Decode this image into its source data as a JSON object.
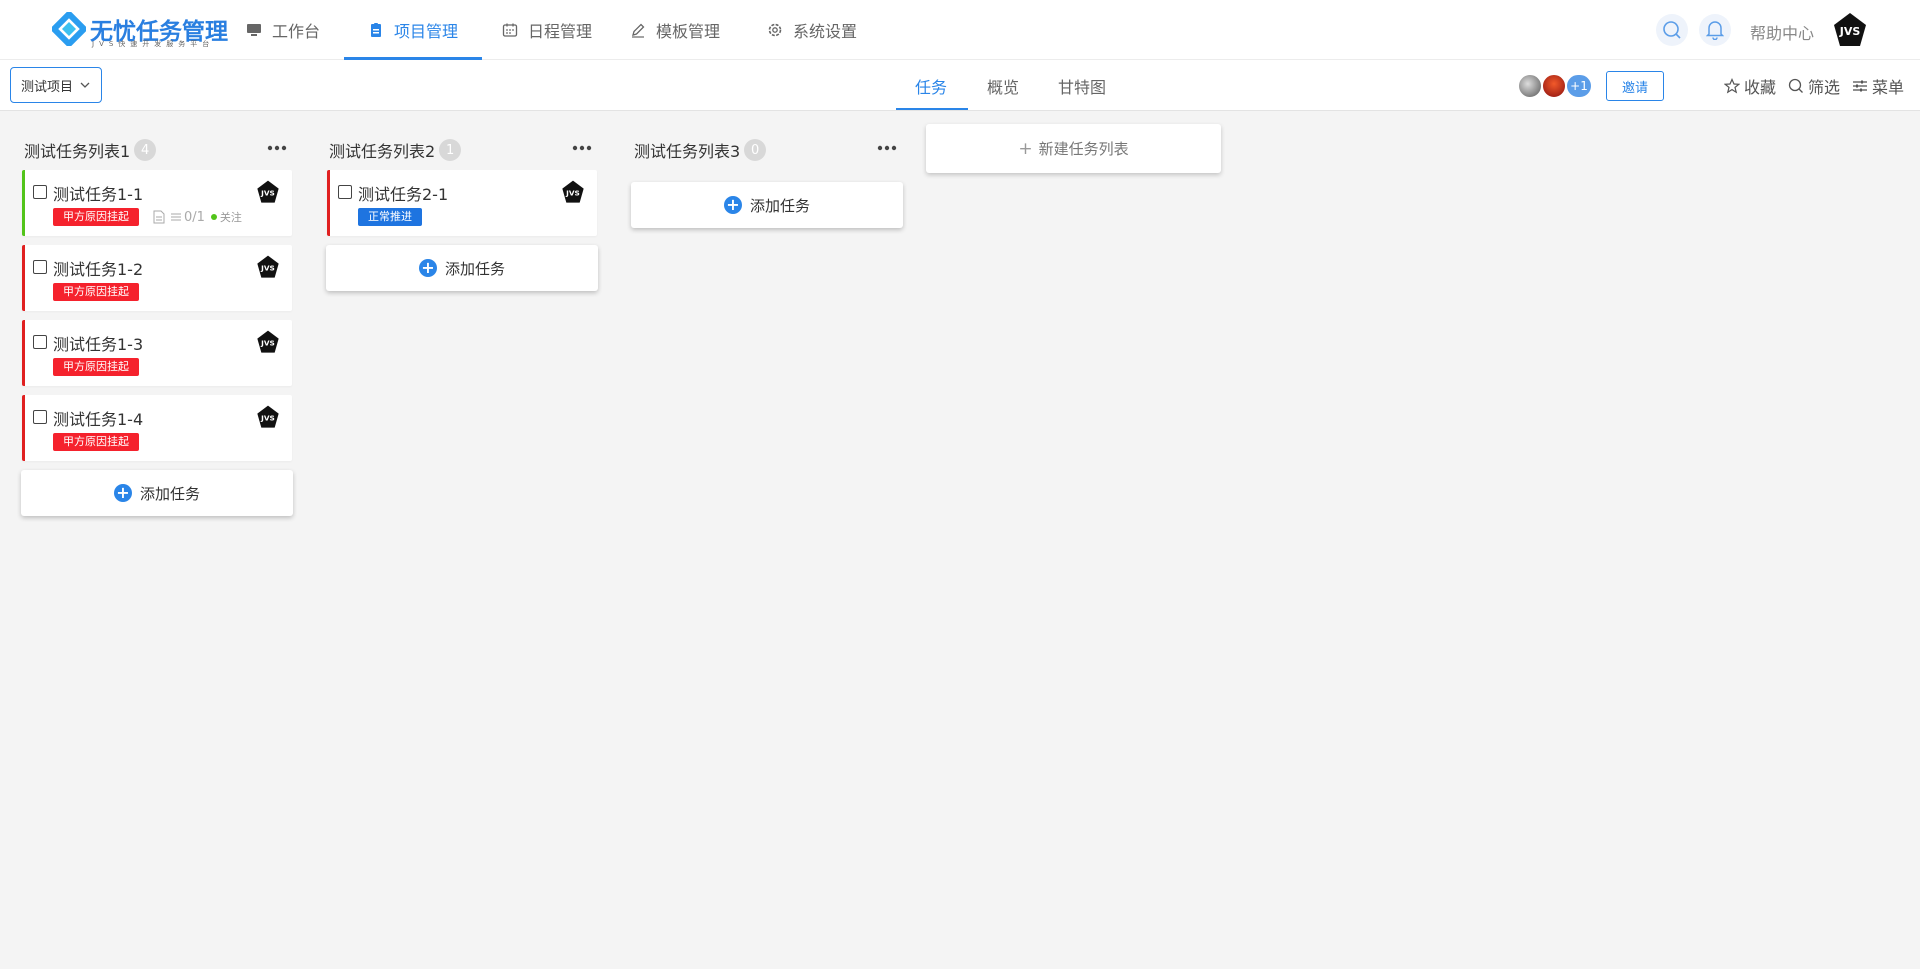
{
  "app": {
    "logo_title": "无忧任务管理",
    "logo_subtitle": "JVS快速开发服务平台"
  },
  "nav": {
    "items": [
      {
        "label": "工作台",
        "icon": "monitor-icon"
      },
      {
        "label": "项目管理",
        "icon": "clipboard-icon",
        "active": true
      },
      {
        "label": "日程管理",
        "icon": "calendar-icon"
      },
      {
        "label": "模板管理",
        "icon": "pen-icon"
      },
      {
        "label": "系统设置",
        "icon": "gear-icon"
      }
    ],
    "help": "帮助中心",
    "accent": "#2a85e8"
  },
  "user": {
    "avatar_text": "JVS"
  },
  "project_bar": {
    "selected_project": "测试项目",
    "tabs": [
      {
        "label": "任务",
        "active": true
      },
      {
        "label": "概览"
      },
      {
        "label": "甘特图"
      }
    ],
    "member_extra": "+1",
    "invite_label": "邀请",
    "tools": [
      {
        "label": "收藏",
        "icon": "star-icon"
      },
      {
        "label": "筛选",
        "icon": "search-icon"
      },
      {
        "label": "菜单",
        "icon": "sliders-icon"
      }
    ]
  },
  "board": {
    "add_task_label": "添加任务",
    "new_list_label": "新建任务列表",
    "columns": [
      {
        "title": "测试任务列表1",
        "count": "4",
        "tasks": [
          {
            "title": "测试任务1-1",
            "tag": "甲方原因挂起",
            "tag_color": "#f5222d",
            "border": "#52c41a",
            "checklist": "0/1",
            "follow": "关注"
          },
          {
            "title": "测试任务1-2",
            "tag": "甲方原因挂起",
            "tag_color": "#f5222d",
            "border": "#e02020"
          },
          {
            "title": "测试任务1-3",
            "tag": "甲方原因挂起",
            "tag_color": "#f5222d",
            "border": "#e02020"
          },
          {
            "title": "测试任务1-4",
            "tag": "甲方原因挂起",
            "tag_color": "#f5222d",
            "border": "#e02020"
          }
        ]
      },
      {
        "title": "测试任务列表2",
        "count": "1",
        "tasks": [
          {
            "title": "测试任务2-1",
            "tag": "正常推进",
            "tag_color": "#1e74e0",
            "border": "#e02020"
          }
        ]
      },
      {
        "title": "测试任务列表3",
        "count": "0",
        "tasks": []
      }
    ]
  }
}
